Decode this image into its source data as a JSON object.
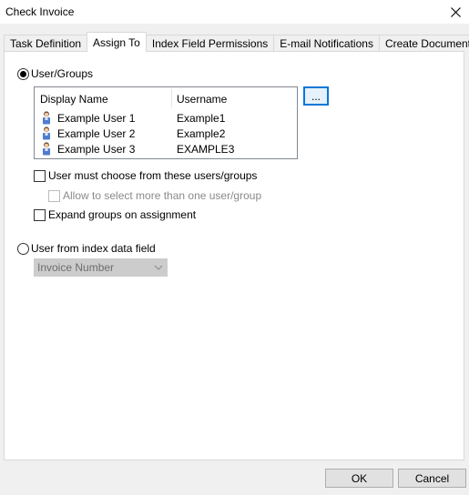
{
  "window": {
    "title": "Check Invoice"
  },
  "tabs": [
    {
      "label": "Task Definition"
    },
    {
      "label": "Assign To"
    },
    {
      "label": "Index Field Permissions"
    },
    {
      "label": "E-mail Notifications"
    },
    {
      "label": "Create Document"
    }
  ],
  "active_tab": "Assign To",
  "assign": {
    "user_groups_label": "User/Groups",
    "user_groups_selected": true,
    "browse_label": "...",
    "list": {
      "columns": {
        "display_name": "Display Name",
        "username": "Username"
      },
      "rows": [
        {
          "display_name": "Example User 1",
          "username": "Example1",
          "icon": "user-icon"
        },
        {
          "display_name": "Example User 2",
          "username": "Example2",
          "icon": "user-icon"
        },
        {
          "display_name": "Example User 3",
          "username": "EXAMPLE3",
          "icon": "user-icon"
        }
      ]
    },
    "must_choose_label": "User must choose from these users/groups",
    "must_choose_checked": false,
    "allow_multiple_label": "Allow to select more than one user/group",
    "allow_multiple_checked": false,
    "expand_groups_label": "Expand groups on assignment",
    "expand_groups_checked": false,
    "index_field_label": "User from index data field",
    "index_field_selected": false,
    "index_field_value": "Invoice Number"
  },
  "footer": {
    "ok_label": "OK",
    "cancel_label": "Cancel"
  },
  "colors": {
    "accent": "#0078d7",
    "window_bg": "#f0f0f0",
    "panel_bg": "#ffffff"
  }
}
